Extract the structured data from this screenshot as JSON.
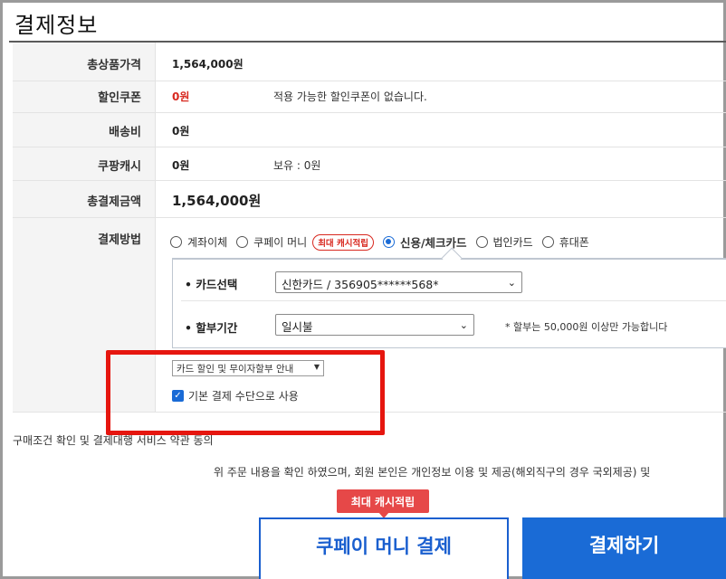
{
  "page_title": "결제정보",
  "rows": [
    {
      "label": "총상품가격",
      "value": "1,564,000원"
    },
    {
      "label": "할인쿠폰",
      "value": "0원",
      "note": "적용 가능한 할인쿠폰이 없습니다."
    },
    {
      "label": "배송비",
      "value": "0원"
    },
    {
      "label": "쿠팡캐시",
      "value": "0원",
      "note": "보유 : 0원"
    },
    {
      "label": "총결제금액",
      "value": "1,564,000원"
    },
    {
      "label": "결제방법"
    }
  ],
  "payment_methods": [
    {
      "label": "계좌이체",
      "selected": false
    },
    {
      "label": "쿠페이 머니",
      "selected": false,
      "badge": "최대 캐시적립"
    },
    {
      "label": "신용/체크카드",
      "selected": true
    },
    {
      "label": "법인카드",
      "selected": false
    },
    {
      "label": "휴대폰",
      "selected": false
    }
  ],
  "card": {
    "select_label": "• 카드선택",
    "select_value": "신한카드 / 356905******568*",
    "installment_label": "• 할부기간",
    "installment_value": "일시불",
    "installment_note": "* 할부는 50,000원 이상만 가능합니다"
  },
  "discount_guide_select": "카드 할인 및 무이자할부 안내",
  "default_method_checkbox": {
    "label": "기본 결제 수단으로 사용",
    "checked": true
  },
  "terms_text": "구매조건 확인 및 결제대행 서비스 약관 동의",
  "agree_text": "위 주문 내용을 확인 하였으며, 회원 본인은 개인정보 이용 및 제공(해외직구의 경우 국외제공) 및",
  "tooltip": "최대 캐시적립",
  "buttons": {
    "coupay": "쿠페이 머니 결제",
    "pay": "결제하기"
  },
  "colors": {
    "accent": "#1a6bd6",
    "highlight": "#e6160f",
    "discount_red": "#d8281f",
    "tooltip": "#e64848"
  }
}
